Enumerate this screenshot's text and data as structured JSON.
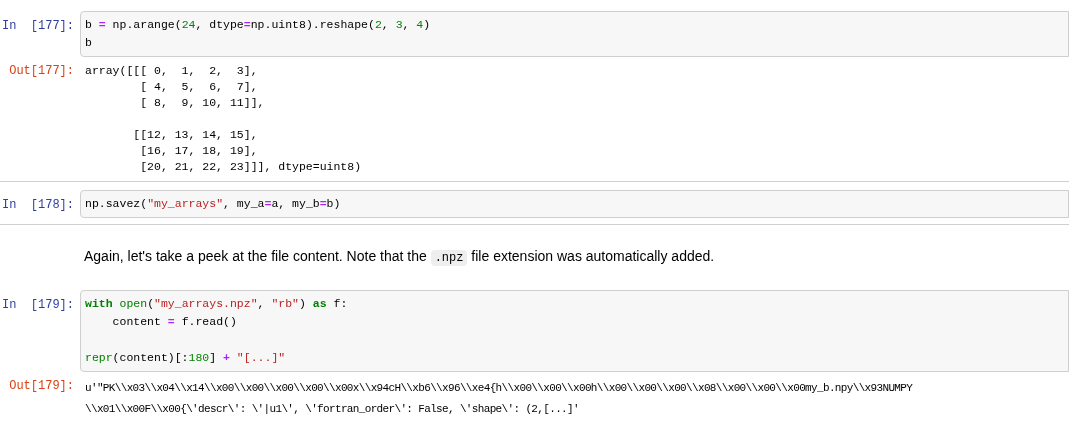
{
  "cells": [
    {
      "kind": "code",
      "prompt": "In  [177]:",
      "input": [
        [
          [
            {
              "text": "b ",
              "kind": "plain"
            },
            {
              "text": "=",
              "kind": "operator"
            },
            {
              "text": " np.arange(",
              "kind": "plain"
            },
            {
              "text": "24",
              "kind": "number"
            },
            {
              "text": ", dtype",
              "kind": "plain"
            },
            {
              "text": "=",
              "kind": "operator"
            },
            {
              "text": "np.uint8).reshape(",
              "kind": "plain"
            },
            {
              "text": "2",
              "kind": "number"
            },
            {
              "text": ", ",
              "kind": "plain"
            },
            {
              "text": "3",
              "kind": "number"
            },
            {
              "text": ", ",
              "kind": "plain"
            },
            {
              "text": "4",
              "kind": "number"
            },
            {
              "text": ")",
              "kind": "plain"
            }
          ],
          [
            {
              "text": "b",
              "kind": "plain"
            }
          ]
        ]
      ],
      "output_prompt": "Out[177]:",
      "output": "array([[[ 0,  1,  2,  3],\n        [ 4,  5,  6,  7],\n        [ 8,  9, 10, 11]],\n\n       [[12, 13, 14, 15],\n        [16, 17, 18, 19],\n        [20, 21, 22, 23]]], dtype=uint8)"
    },
    {
      "kind": "code",
      "prompt": "In  [178]:",
      "input": [
        [
          [
            {
              "text": "np.savez(",
              "kind": "plain"
            },
            {
              "text": "\"my_arrays\"",
              "kind": "string"
            },
            {
              "text": ", my_a",
              "kind": "plain"
            },
            {
              "text": "=",
              "kind": "operator"
            },
            {
              "text": "a, my_b",
              "kind": "plain"
            },
            {
              "text": "=",
              "kind": "operator"
            },
            {
              "text": "b)",
              "kind": "plain"
            }
          ]
        ]
      ]
    },
    {
      "kind": "markdown",
      "parts": [
        {
          "text": "Again, let's take a peek at the file content. Note that the ",
          "kind": "text"
        },
        {
          "text": ".npz",
          "kind": "code"
        },
        {
          "text": " file extension was automatically added.",
          "kind": "text"
        }
      ]
    },
    {
      "kind": "code",
      "prompt": "In  [179]:",
      "input": [
        [
          [
            {
              "text": "with",
              "kind": "keyword"
            },
            {
              "text": " open",
              "kind": "builtin"
            },
            {
              "text": "(",
              "kind": "plain"
            },
            {
              "text": "\"my_arrays.npz\"",
              "kind": "string"
            },
            {
              "text": ", ",
              "kind": "plain"
            },
            {
              "text": "\"rb\"",
              "kind": "string"
            },
            {
              "text": ") ",
              "kind": "plain"
            },
            {
              "text": "as",
              "kind": "keyword"
            },
            {
              "text": " f:",
              "kind": "plain"
            }
          ],
          [
            {
              "text": "    content ",
              "kind": "plain"
            },
            {
              "text": "=",
              "kind": "operator"
            },
            {
              "text": " f.read()",
              "kind": "plain"
            }
          ]
        ],
        [
          [
            {
              "text": "repr",
              "kind": "builtin"
            },
            {
              "text": "(content)[:",
              "kind": "plain"
            },
            {
              "text": "180",
              "kind": "number"
            },
            {
              "text": "] ",
              "kind": "plain"
            },
            {
              "text": "+",
              "kind": "operator"
            },
            {
              "text": " \"[...]\"",
              "kind": "string"
            }
          ]
        ]
      ],
      "output_prompt": "Out[179]:",
      "output": "u'\"PK\\\\x03\\\\x04\\\\x14\\\\x00\\\\x00\\\\x00\\\\x00\\\\x00x\\\\x94cH\\\\xb6\\\\x96\\\\xe4{h\\\\x00\\\\x00\\\\x00h\\\\x00\\\\x00\\\\x00\\\\x08\\\\x00\\\\x00\\\\x00my_b.npy\\\\x93NUMPY\n\\\\x01\\\\x00F\\\\x00{\\'descr\\': \\'|u1\\', \\'fortran_order\\': False, \\'shape\\': (2,[...]'"
    }
  ]
}
